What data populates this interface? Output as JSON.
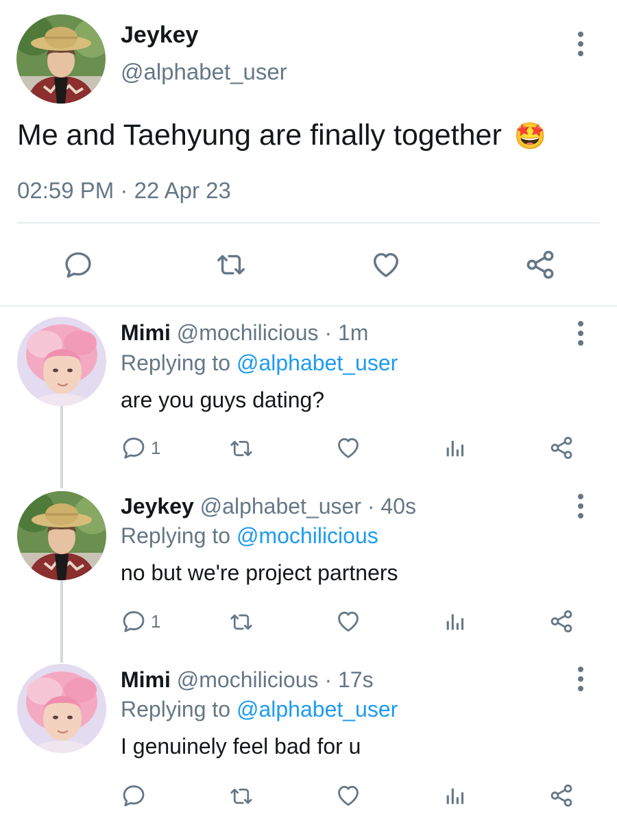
{
  "main_tweet": {
    "display_name": "Jeykey",
    "handle": "@alphabet_user",
    "text": "Me and Taehyung are finally together",
    "emoji": "🤩",
    "timestamp": "02:59 PM · 22 Apr 23"
  },
  "replies": [
    {
      "display_name": "Mimi",
      "handle": "@mochilicious",
      "age": "· 1m",
      "replying_label": "Replying to",
      "replying_to": "@alphabet_user",
      "text": "are you guys dating?",
      "reply_count": "1"
    },
    {
      "display_name": "Jeykey",
      "handle": "@alphabet_user",
      "age": "· 40s",
      "replying_label": "Replying to",
      "replying_to": "@mochilicious",
      "text": "no but we're project partners",
      "reply_count": "1"
    },
    {
      "display_name": "Mimi",
      "handle": "@mochilicious",
      "age": "· 17s",
      "replying_label": "Replying to",
      "replying_to": "@alphabet_user",
      "text": "I genuinely feel bad for u",
      "reply_count": ""
    }
  ],
  "icons": {
    "reply": "reply-bubble-icon",
    "retweet": "retweet-icon",
    "like": "heart-icon",
    "analytics": "analytics-bars-icon",
    "share": "share-icon",
    "more": "more-vertical-icon"
  },
  "colors": {
    "link": "#1d9bf0",
    "secondary_text": "#657786",
    "divider": "#e6ecf0"
  }
}
